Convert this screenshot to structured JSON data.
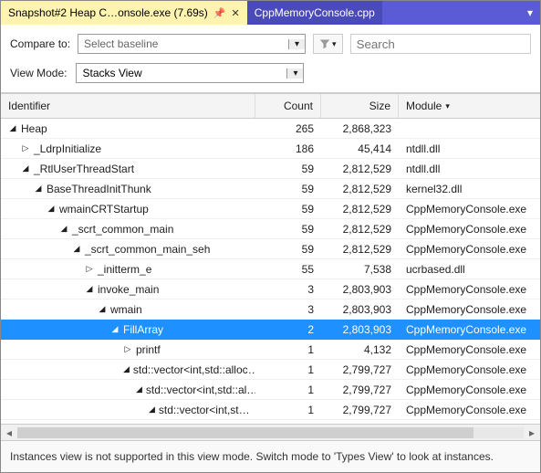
{
  "tabs": {
    "active": {
      "label": "Snapshot#2 Heap C…onsole.exe (7.69s)"
    },
    "inactive": {
      "label": "CppMemoryConsole.cpp"
    }
  },
  "toolbar": {
    "compare_label": "Compare to:",
    "baseline_placeholder": "Select baseline",
    "search_placeholder": "Search",
    "viewmode_label": "View Mode:",
    "viewmode_value": "Stacks View"
  },
  "columns": {
    "identifier": "Identifier",
    "count": "Count",
    "size": "Size",
    "module": "Module"
  },
  "rows": [
    {
      "depth": 0,
      "tw": "◢",
      "name": "Heap",
      "count": "265",
      "size": "2,868,323",
      "module": "",
      "sel": false
    },
    {
      "depth": 1,
      "tw": "▷",
      "name": "_LdrpInitialize",
      "count": "186",
      "size": "45,414",
      "module": "ntdll.dll",
      "sel": false
    },
    {
      "depth": 1,
      "tw": "◢",
      "name": "_RtlUserThreadStart",
      "count": "59",
      "size": "2,812,529",
      "module": "ntdll.dll",
      "sel": false
    },
    {
      "depth": 2,
      "tw": "◢",
      "name": "BaseThreadInitThunk",
      "count": "59",
      "size": "2,812,529",
      "module": "kernel32.dll",
      "sel": false
    },
    {
      "depth": 3,
      "tw": "◢",
      "name": "wmainCRTStartup",
      "count": "59",
      "size": "2,812,529",
      "module": "CppMemoryConsole.exe",
      "sel": false
    },
    {
      "depth": 4,
      "tw": "◢",
      "name": "_scrt_common_main",
      "count": "59",
      "size": "2,812,529",
      "module": "CppMemoryConsole.exe",
      "sel": false
    },
    {
      "depth": 5,
      "tw": "◢",
      "name": "_scrt_common_main_seh",
      "count": "59",
      "size": "2,812,529",
      "module": "CppMemoryConsole.exe",
      "sel": false
    },
    {
      "depth": 6,
      "tw": "▷",
      "name": "_initterm_e",
      "count": "55",
      "size": "7,538",
      "module": "ucrbased.dll",
      "sel": false
    },
    {
      "depth": 6,
      "tw": "◢",
      "name": "invoke_main",
      "count": "3",
      "size": "2,803,903",
      "module": "CppMemoryConsole.exe",
      "sel": false
    },
    {
      "depth": 7,
      "tw": "◢",
      "name": "wmain",
      "count": "3",
      "size": "2,803,903",
      "module": "CppMemoryConsole.exe",
      "sel": false
    },
    {
      "depth": 8,
      "tw": "◢",
      "name": "FillArray",
      "count": "2",
      "size": "2,803,903",
      "module": "CppMemoryConsole.exe",
      "sel": true
    },
    {
      "depth": 9,
      "tw": "▷",
      "name": "printf",
      "count": "1",
      "size": "4,132",
      "module": "CppMemoryConsole.exe",
      "sel": false
    },
    {
      "depth": 9,
      "tw": "◢",
      "name": "std::vector<int,std::alloc…",
      "count": "1",
      "size": "2,799,727",
      "module": "CppMemoryConsole.exe",
      "sel": false
    },
    {
      "depth": 10,
      "tw": "◢",
      "name": "std::vector<int,std::al…",
      "count": "1",
      "size": "2,799,727",
      "module": "CppMemoryConsole.exe",
      "sel": false
    },
    {
      "depth": 11,
      "tw": "◢",
      "name": "std::vector<int,st…",
      "count": "1",
      "size": "2,799,727",
      "module": "CppMemoryConsole.exe",
      "sel": false
    }
  ],
  "footer": "Instances view is not supported in this view mode. Switch mode to 'Types View' to look at instances."
}
